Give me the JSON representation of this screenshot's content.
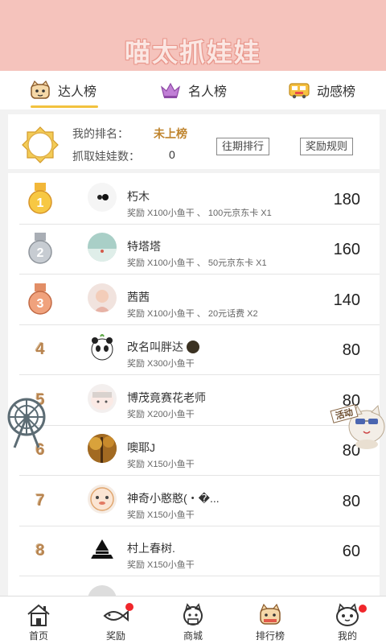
{
  "header": {
    "title": "喵太抓娃娃"
  },
  "tabs": [
    {
      "label": "达人榜",
      "icon": "cat-face-icon",
      "active": true
    },
    {
      "label": "名人榜",
      "icon": "crown-icon",
      "active": false
    },
    {
      "label": "动感榜",
      "icon": "bus-icon",
      "active": false
    }
  ],
  "my_rank": {
    "rank_label": "我的排名：",
    "rank_value": "未上榜",
    "count_label": "抓取娃娃数：",
    "count_value": "0",
    "history_button": "往期排行",
    "rules_button": "奖励规则"
  },
  "ranking": [
    {
      "rank": "1",
      "name": "朽木",
      "reward": "奖励 X100小鱼干 、 100元京东卡 X1",
      "score": "180",
      "medal": "gold"
    },
    {
      "rank": "2",
      "name": "特塔塔",
      "reward": "奖励 X100小鱼干 、 50元京东卡 X1",
      "score": "160",
      "medal": "silver"
    },
    {
      "rank": "3",
      "name": "茜茜",
      "reward": "奖励 X100小鱼干 、 20元话费 X2",
      "score": "140",
      "medal": "bronze"
    },
    {
      "rank": "4",
      "name": "改名叫胖达",
      "reward": "奖励 X300小鱼干",
      "score": "80"
    },
    {
      "rank": "5",
      "name": "博茂竟赛花老师",
      "reward": "奖励 X200小鱼干",
      "score": "80"
    },
    {
      "rank": "6",
      "name": "噢耶J",
      "reward": "奖励 X150小鱼干",
      "score": "80"
    },
    {
      "rank": "7",
      "name": "神奇小憨憨(・�...",
      "reward": "奖励 X150小鱼干",
      "score": "80"
    },
    {
      "rank": "8",
      "name": "村上春树.",
      "reward": "奖励 X150小鱼干",
      "score": "60"
    }
  ],
  "float_badge": "活动",
  "nav": [
    {
      "label": "首页",
      "icon": "house-icon",
      "dot": false
    },
    {
      "label": "奖励",
      "icon": "fish-icon",
      "dot": true
    },
    {
      "label": "商城",
      "icon": "cat-shop-icon",
      "dot": false
    },
    {
      "label": "排行榜",
      "icon": "ranking-cat-icon",
      "dot": false,
      "active": true
    },
    {
      "label": "我的",
      "icon": "cat-profile-icon",
      "dot": true
    }
  ],
  "colors": {
    "header": "#f5c3bc",
    "tab_underline": "#f2c23e",
    "rank_value": "#c0852f",
    "red_dot": "#f0262b"
  }
}
